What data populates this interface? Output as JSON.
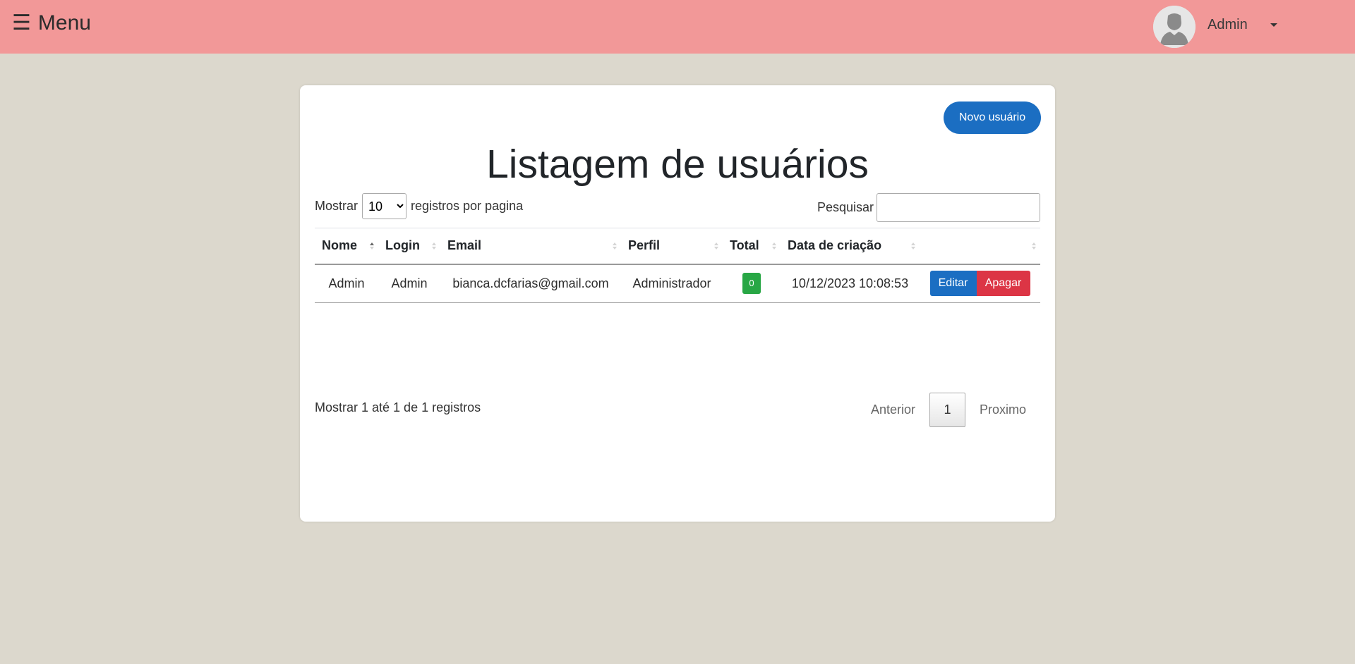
{
  "topbar": {
    "menu_icon": "☰",
    "menu_label": "Menu",
    "user_name": "Admin"
  },
  "card": {
    "new_button_label": "Novo usuário",
    "title": "Listagem de usuários",
    "length": {
      "prefix": "Mostrar",
      "selected": "10",
      "options": [
        "10"
      ],
      "suffix": "registros por pagina"
    },
    "search": {
      "label": "Pesquisar",
      "value": ""
    },
    "table": {
      "columns": [
        "Nome",
        "Login",
        "Email",
        "Perfil",
        "Total",
        "Data de criação",
        ""
      ],
      "rows": [
        {
          "nome": "Admin",
          "login": "Admin",
          "email": "bianca.dcfarias@gmail.com",
          "perfil": "Administrador",
          "total": "0",
          "data": "10/12/2023 10:08:53",
          "edit_label": "Editar",
          "delete_label": "Apagar"
        }
      ]
    },
    "info": "Mostrar 1 até 1 de 1 registros",
    "pagination": {
      "previous": "Anterior",
      "current": "1",
      "next": "Proximo"
    }
  },
  "colors": {
    "topbar": "#f29898",
    "background": "#dcd8cd",
    "primary": "#1b6ec2",
    "danger": "#dc3545",
    "success": "#28a745"
  }
}
